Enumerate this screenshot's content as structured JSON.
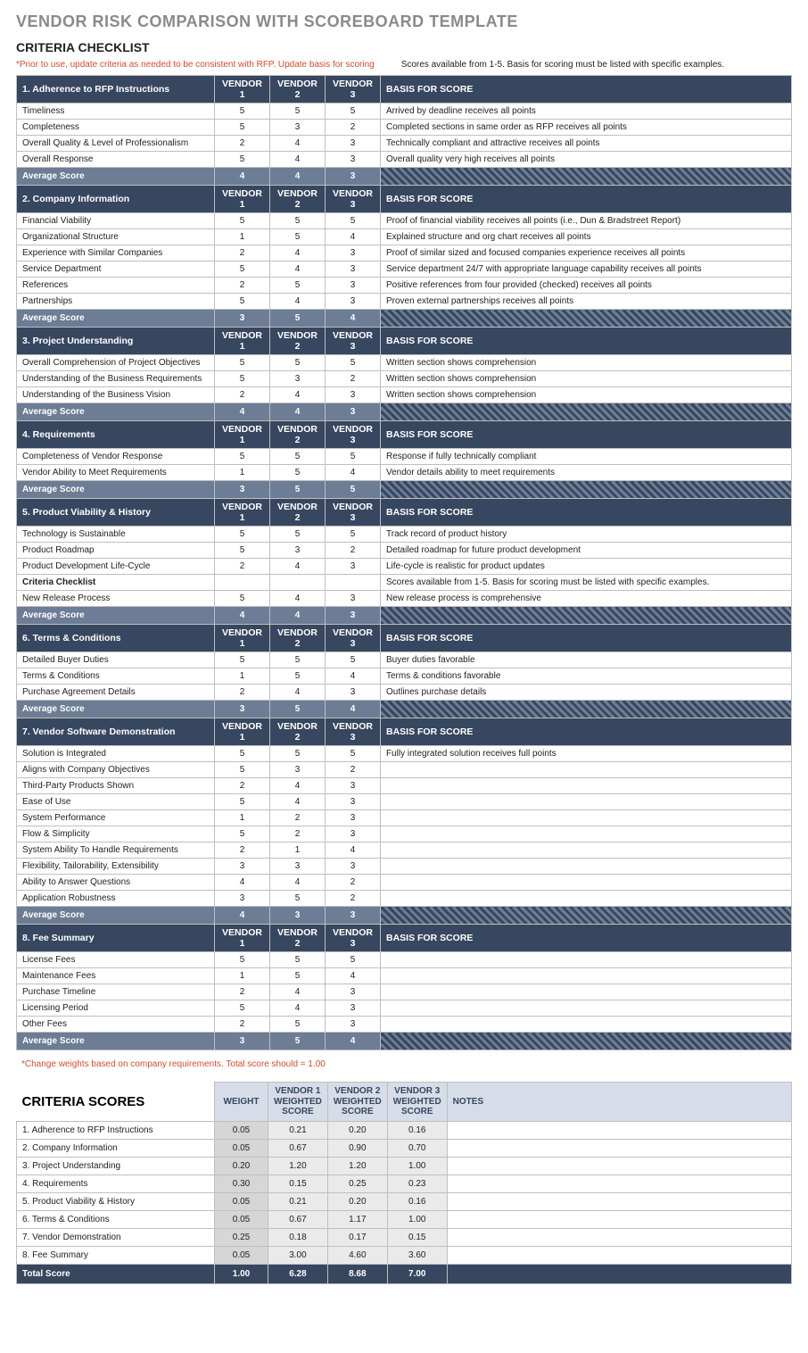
{
  "title": "VENDOR RISK COMPARISON WITH SCOREBOARD TEMPLATE",
  "subtitle": "CRITERIA CHECKLIST",
  "note_red": "*Prior to use, update criteria as needed to be consistent with RFP. Update basis for scoring",
  "note_black": "Scores available from 1-5. Basis for scoring must be listed with specific examples.",
  "vendor_labels": [
    "VENDOR 1",
    "VENDOR 2",
    "VENDOR 3"
  ],
  "basis_label": "BASIS FOR SCORE",
  "avg_label": "Average Score",
  "sections": [
    {
      "header": "1. Adherence to RFP Instructions",
      "rows": [
        {
          "name": "Timeliness",
          "v": [
            "5",
            "5",
            "5"
          ],
          "basis": "Arrived by deadline receives all points"
        },
        {
          "name": "Completeness",
          "v": [
            "5",
            "3",
            "2"
          ],
          "basis": "Completed sections in same order as RFP receives all points"
        },
        {
          "name": "Overall Quality & Level of Professionalism",
          "v": [
            "2",
            "4",
            "3"
          ],
          "basis": "Technically compliant and attractive receives all points"
        },
        {
          "name": "Overall Response",
          "v": [
            "5",
            "4",
            "3"
          ],
          "basis": "Overall quality very high receives all points"
        }
      ],
      "avg": [
        "4",
        "4",
        "3"
      ]
    },
    {
      "header": "2. Company Information",
      "rows": [
        {
          "name": "Financial Viability",
          "v": [
            "5",
            "5",
            "5"
          ],
          "basis": "Proof of financial viability receives all points (i.e., Dun & Bradstreet Report)"
        },
        {
          "name": "Organizational Structure",
          "v": [
            "1",
            "5",
            "4"
          ],
          "basis": "Explained structure and org chart receives all points"
        },
        {
          "name": "Experience with Similar Companies",
          "v": [
            "2",
            "4",
            "3"
          ],
          "basis": "Proof of similar sized and focused companies experience receives all points"
        },
        {
          "name": "Service Department",
          "v": [
            "5",
            "4",
            "3"
          ],
          "basis": "Service department 24/7 with appropriate language capability receives all points"
        },
        {
          "name": "References",
          "v": [
            "2",
            "5",
            "3"
          ],
          "basis": "Positive references from four provided (checked) receives all points"
        },
        {
          "name": "Partnerships",
          "v": [
            "5",
            "4",
            "3"
          ],
          "basis": "Proven external partnerships receives all points"
        }
      ],
      "avg": [
        "3",
        "5",
        "4"
      ]
    },
    {
      "header": "3. Project Understanding",
      "rows": [
        {
          "name": "Overall Comprehension of Project Objectives",
          "v": [
            "5",
            "5",
            "5"
          ],
          "basis": "Written section shows comprehension"
        },
        {
          "name": "Understanding of the Business Requirements",
          "v": [
            "5",
            "3",
            "2"
          ],
          "basis": "Written section shows comprehension"
        },
        {
          "name": "Understanding of the Business Vision",
          "v": [
            "2",
            "4",
            "3"
          ],
          "basis": "Written section shows comprehension"
        }
      ],
      "avg": [
        "4",
        "4",
        "3"
      ]
    },
    {
      "header": "4. Requirements",
      "rows": [
        {
          "name": "Completeness of Vendor Response",
          "v": [
            "5",
            "5",
            "5"
          ],
          "basis": "Response if fully technically compliant"
        },
        {
          "name": "Vendor Ability to Meet Requirements",
          "v": [
            "1",
            "5",
            "4"
          ],
          "basis": "Vendor details ability to meet requirements"
        }
      ],
      "avg": [
        "3",
        "5",
        "5"
      ]
    },
    {
      "header": "5. Product Viability & History",
      "rows": [
        {
          "name": "Technology is Sustainable",
          "v": [
            "5",
            "5",
            "5"
          ],
          "basis": "Track record of product history"
        },
        {
          "name": "Product Roadmap",
          "v": [
            "5",
            "3",
            "2"
          ],
          "basis": "Detailed roadmap for future product development"
        },
        {
          "name": "Product Development Life-Cycle",
          "v": [
            "2",
            "4",
            "3"
          ],
          "basis": "Life-cycle is realistic for product updates"
        },
        {
          "name": "Criteria Checklist",
          "bold": true,
          "v": [
            "",
            "",
            ""
          ],
          "basis": "Scores available from 1-5. Basis for scoring must be listed with specific examples."
        },
        {
          "name": "New Release Process",
          "v": [
            "5",
            "4",
            "3"
          ],
          "basis": "New release process is comprehensive"
        }
      ],
      "avg": [
        "4",
        "4",
        "3"
      ]
    },
    {
      "header": "6. Terms & Conditions",
      "rows": [
        {
          "name": "Detailed Buyer Duties",
          "v": [
            "5",
            "5",
            "5"
          ],
          "basis": "Buyer duties favorable"
        },
        {
          "name": "Terms & Conditions",
          "v": [
            "1",
            "5",
            "4"
          ],
          "basis": "Terms & conditions favorable"
        },
        {
          "name": "Purchase Agreement Details",
          "v": [
            "2",
            "4",
            "3"
          ],
          "basis": "Outlines purchase details"
        }
      ],
      "avg": [
        "3",
        "5",
        "4"
      ]
    },
    {
      "header": "7. Vendor Software Demonstration",
      "rows": [
        {
          "name": "Solution is Integrated",
          "v": [
            "5",
            "5",
            "5"
          ],
          "basis": "Fully integrated solution receives full points"
        },
        {
          "name": "Aligns with Company Objectives",
          "v": [
            "5",
            "3",
            "2"
          ],
          "basis": ""
        },
        {
          "name": "Third-Party Products Shown",
          "v": [
            "2",
            "4",
            "3"
          ],
          "basis": ""
        },
        {
          "name": "Ease of Use",
          "v": [
            "5",
            "4",
            "3"
          ],
          "basis": ""
        },
        {
          "name": "System Performance",
          "v": [
            "1",
            "2",
            "3"
          ],
          "basis": ""
        },
        {
          "name": "Flow & Simplicity",
          "v": [
            "5",
            "2",
            "3"
          ],
          "basis": ""
        },
        {
          "name": "System Ability To Handle Requirements",
          "v": [
            "2",
            "1",
            "4"
          ],
          "basis": ""
        },
        {
          "name": "Flexibility, Tailorability, Extensibility",
          "v": [
            "3",
            "3",
            "3"
          ],
          "basis": ""
        },
        {
          "name": "Ability to Answer Questions",
          "v": [
            "4",
            "4",
            "2"
          ],
          "basis": ""
        },
        {
          "name": "Application Robustness",
          "v": [
            "3",
            "5",
            "2"
          ],
          "basis": ""
        }
      ],
      "avg": [
        "4",
        "3",
        "3"
      ]
    },
    {
      "header": "8. Fee Summary",
      "rows": [
        {
          "name": "License Fees",
          "v": [
            "5",
            "5",
            "5"
          ],
          "basis": ""
        },
        {
          "name": "Maintenance Fees",
          "v": [
            "1",
            "5",
            "4"
          ],
          "basis": ""
        },
        {
          "name": "Purchase Timeline",
          "v": [
            "2",
            "4",
            "3"
          ],
          "basis": ""
        },
        {
          "name": "Licensing Period",
          "v": [
            "5",
            "4",
            "3"
          ],
          "basis": ""
        },
        {
          "name": "Other Fees",
          "v": [
            "2",
            "5",
            "3"
          ],
          "basis": ""
        }
      ],
      "avg": [
        "3",
        "5",
        "4"
      ]
    }
  ],
  "footnote": "*Change weights based on company requirements. Total score should = 1.00",
  "scores_title": "CRITERIA SCORES",
  "scores_headers": {
    "weight": "WEIGHT",
    "v1": "VENDOR 1 WEIGHTED SCORE",
    "v2": "VENDOR 2 WEIGHTED SCORE",
    "v3": "VENDOR 3 WEIGHTED SCORE",
    "notes": "NOTES"
  },
  "scores_rows": [
    {
      "name": "1. Adherence to RFP Instructions",
      "weight": "0.05",
      "v": [
        "0.21",
        "0.20",
        "0.16"
      ],
      "notes": ""
    },
    {
      "name": "2. Company Information",
      "weight": "0.05",
      "v": [
        "0.67",
        "0.90",
        "0.70"
      ],
      "notes": ""
    },
    {
      "name": "3. Project Understanding",
      "weight": "0.20",
      "v": [
        "1.20",
        "1.20",
        "1.00"
      ],
      "notes": ""
    },
    {
      "name": "4. Requirements",
      "weight": "0.30",
      "v": [
        "0.15",
        "0.25",
        "0.23"
      ],
      "notes": ""
    },
    {
      "name": "5. Product Viability & History",
      "weight": "0.05",
      "v": [
        "0.21",
        "0.20",
        "0.16"
      ],
      "notes": ""
    },
    {
      "name": "6. Terms & Conditions",
      "weight": "0.05",
      "v": [
        "0.67",
        "1.17",
        "1.00"
      ],
      "notes": ""
    },
    {
      "name": "7. Vendor Demonstration",
      "weight": "0.25",
      "v": [
        "0.18",
        "0.17",
        "0.15"
      ],
      "notes": ""
    },
    {
      "name": "8. Fee Summary",
      "weight": "0.05",
      "v": [
        "3.00",
        "4.60",
        "3.60"
      ],
      "notes": ""
    }
  ],
  "total": {
    "name": "Total Score",
    "weight": "1.00",
    "v": [
      "6.28",
      "8.68",
      "7.00"
    ]
  }
}
